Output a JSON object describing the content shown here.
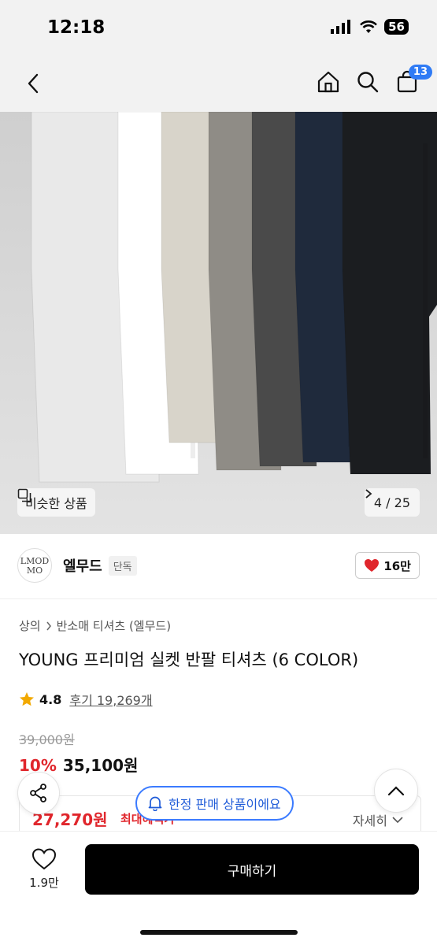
{
  "status": {
    "time": "12:18",
    "battery": "56"
  },
  "nav": {
    "cart_count": "13"
  },
  "hero": {
    "similar_label": "비슷한 상품",
    "page_indicator": "4 / 25",
    "shirt_colors": [
      "#e9e9e9",
      "#ffffff",
      "#d8d4ca",
      "#8f8c86",
      "#4a4a4a",
      "#1f2a3c",
      "#1b1d20"
    ]
  },
  "brand": {
    "logo_text": "LMOD MO",
    "name": "엘무드",
    "tag": "단독",
    "likes": "16만"
  },
  "breadcrumb": {
    "category": "상의",
    "subcategory": "반소매 티셔츠 (엘무드)"
  },
  "product": {
    "title": "YOUNG 프리미엄 실켓 반팔 티셔츠 (6 COLOR)",
    "rating": "4.8",
    "reviews": "후기 19,269개",
    "original_price": "39,000원",
    "discount": "10%",
    "sale_price": "35,100원"
  },
  "limited": {
    "label": "한정 판매 상품이에요"
  },
  "coupon": {
    "price": "27,270원",
    "label": "최대혜택가",
    "detail": "자세히"
  },
  "bottom": {
    "wish_count": "1.9만",
    "buy_label": "구매하기"
  }
}
